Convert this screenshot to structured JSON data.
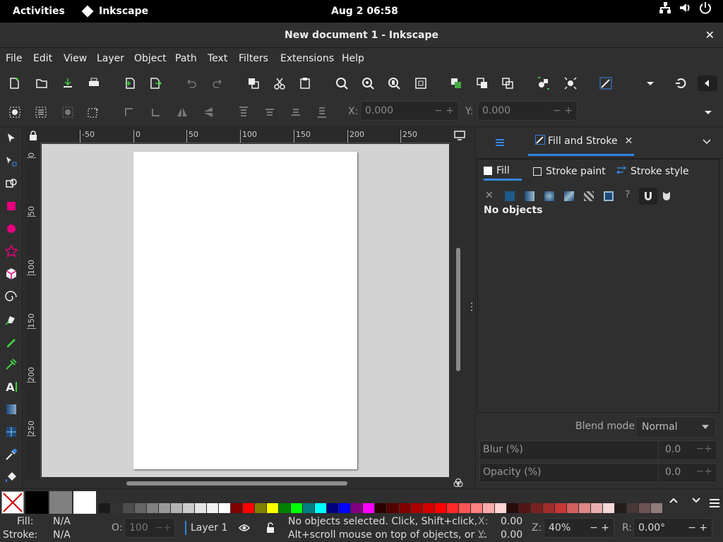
{
  "topbar": {
    "activities": "Activities",
    "app": "Inkscape",
    "clock": "Aug 2  06:58"
  },
  "window": {
    "title": "New document 1 - Inkscape"
  },
  "menubar": [
    "File",
    "Edit",
    "View",
    "Layer",
    "Object",
    "Path",
    "Text",
    "Filters",
    "Extensions",
    "Help"
  ],
  "toolbar": {
    "x_label": "X:",
    "x_value": "0.000",
    "y_label": "Y:",
    "y_value": "0.000"
  },
  "rulers": {
    "h": [
      "-50",
      "0",
      "50",
      "100",
      "150",
      "200",
      "250"
    ],
    "v": [
      "0",
      "50",
      "100",
      "150",
      "200",
      "250"
    ]
  },
  "dock": {
    "tab_label": "Fill and Stroke",
    "fill_tab": "Fill",
    "stroke_paint_tab": "Stroke paint",
    "stroke_style_tab": "Stroke style",
    "no_objects": "No objects",
    "blend_label": "Blend mode:",
    "blend_value": "Normal",
    "blur_label": "Blur (%)",
    "blur_value": "0.0",
    "opacity_label": "Opacity (%)",
    "opacity_value": "0.0"
  },
  "palette": [
    "#000000",
    "#808080",
    "#ffffff",
    "#1a1a1a",
    "#333333",
    "#4d4d4d",
    "#666666",
    "#808080",
    "#999999",
    "#b3b3b3",
    "#cccccc",
    "#e6e6e6",
    "#f2f2f2",
    "#ffffff",
    "#800000",
    "#ff0000",
    "#808000",
    "#ffff00",
    "#008000",
    "#00ff00",
    "#008080",
    "#00ffff",
    "#000080",
    "#0000ff",
    "#800080",
    "#ff00ff",
    "#2b0000",
    "#550000",
    "#800000",
    "#aa0000",
    "#d40000",
    "#ff0000",
    "#ff2a2a",
    "#ff5555",
    "#ff8080",
    "#ffaaaa",
    "#ffd5d5",
    "#280b0b",
    "#501616",
    "#782121",
    "#a02c2c",
    "#c83737",
    "#d35f5f",
    "#de8787",
    "#e9afaf",
    "#f4d7d7",
    "#241c1c",
    "#483737",
    "#6c5353",
    "#917c7c"
  ],
  "status": {
    "fill_label": "Fill:",
    "fill_value": "N/A",
    "stroke_label": "Stroke:",
    "stroke_value": "N/A",
    "opacity_label": "O:",
    "opacity_value": "100",
    "layer": "Layer 1",
    "message_line1": "No objects selected. Click, Shift+click,",
    "message_line2": "Alt+scroll mouse on top of objects, or ...",
    "x_label": "X:",
    "x_value": "0.00",
    "y_label": "Y:",
    "y_value": "0.00",
    "zoom_label": "Z:",
    "zoom_value": "40%",
    "rotation_label": "R:",
    "rotation_value": "0.00°"
  },
  "colors": {
    "accent": "#3584e4",
    "selection": "#e5007e"
  }
}
